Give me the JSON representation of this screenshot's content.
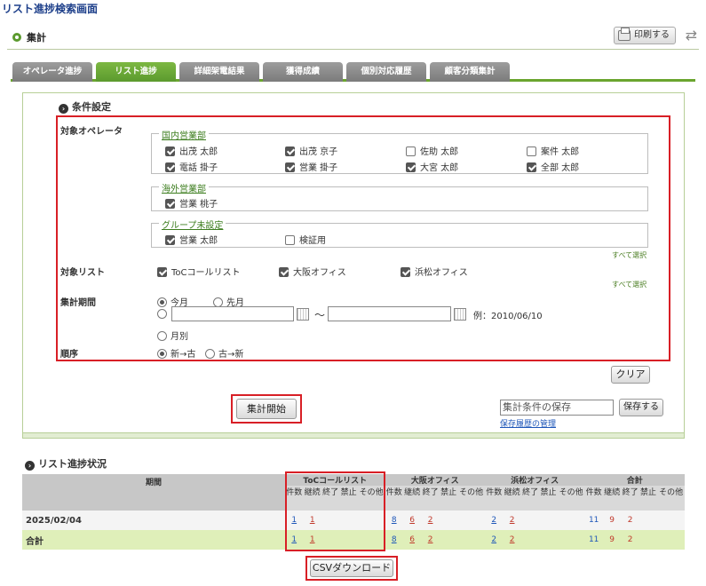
{
  "screen_title": "リスト進捗検索画面",
  "header": {
    "title": "集計",
    "print_label": "印刷する"
  },
  "tabs": [
    {
      "label": "オペレータ進捗",
      "active": false
    },
    {
      "label": "リスト進捗",
      "active": true
    },
    {
      "label": "詳細架電結果",
      "active": false
    },
    {
      "label": "獲得成績",
      "active": false
    },
    {
      "label": "個別対応履歴",
      "active": false
    },
    {
      "label": "顧客分類集計",
      "active": false
    }
  ],
  "conditions": {
    "title": "条件設定",
    "operator_label": "対象オペレータ",
    "groups": [
      {
        "name": "国内営業部",
        "items": [
          {
            "label": "出茂 太郎",
            "checked": true
          },
          {
            "label": "出茂 京子",
            "checked": true
          },
          {
            "label": "佐助 太郎",
            "checked": false
          },
          {
            "label": "案件 太郎",
            "checked": false
          },
          {
            "label": "電話 掛子",
            "checked": true
          },
          {
            "label": "営業 掛子",
            "checked": true
          },
          {
            "label": "大宮 太郎",
            "checked": true
          },
          {
            "label": "全部 太郎",
            "checked": true
          }
        ]
      },
      {
        "name": "海外営業部",
        "items": [
          {
            "label": "営業 桃子",
            "checked": true
          }
        ]
      },
      {
        "name": "グループ未設定",
        "items": [
          {
            "label": "営業 太郎",
            "checked": true
          },
          {
            "label": "検証用",
            "checked": false
          }
        ]
      }
    ],
    "select_all": "すべて選択",
    "list_label": "対象リスト",
    "lists": [
      {
        "label": "ToCコールリスト",
        "checked": true
      },
      {
        "label": "大阪オフィス",
        "checked": true
      },
      {
        "label": "浜松オフィス",
        "checked": true
      }
    ],
    "period_label": "集計期間",
    "period_options": {
      "this_month": "今月",
      "last_month": "先月",
      "monthly": "月別"
    },
    "tilde": "～",
    "date_example": "例：2010/06/10",
    "order_label": "順序",
    "order_options": {
      "new_old": "新→古",
      "old_new": "古→新"
    },
    "clear_label": "クリア",
    "start_label": "集計開始",
    "save_placeholder": "集計条件の保存",
    "save_label": "保存する",
    "history_link": "保存履歴の管理"
  },
  "results": {
    "title": "リスト進捗状況",
    "period_header": "期間",
    "groups": [
      "ToCコールリスト",
      "大阪オフィス",
      "浜松オフィス",
      "合計"
    ],
    "sub_headers": [
      "件数",
      "継続",
      "終了",
      "禁止",
      "その他"
    ],
    "rows": [
      {
        "label": "2025/02/04",
        "cells": [
          [
            "1",
            "1",
            "",
            "",
            ""
          ],
          [
            "8",
            "6",
            "2",
            "",
            ""
          ],
          [
            "2",
            "2",
            "",
            "",
            ""
          ],
          [
            "11",
            "9",
            "2",
            "",
            ""
          ]
        ]
      },
      {
        "label": "合計",
        "cells": [
          [
            "1",
            "1",
            "",
            "",
            ""
          ],
          [
            "8",
            "6",
            "2",
            "",
            ""
          ],
          [
            "2",
            "2",
            "",
            "",
            ""
          ],
          [
            "11",
            "9",
            "2",
            "",
            ""
          ]
        ]
      }
    ],
    "csv_label": "CSVダウンロード"
  },
  "colors": {
    "accent_green": "#5b9a2e",
    "highlight_red": "#d81f26",
    "total_row": "#dfefb9",
    "title_blue": "#1d3f8a"
  }
}
